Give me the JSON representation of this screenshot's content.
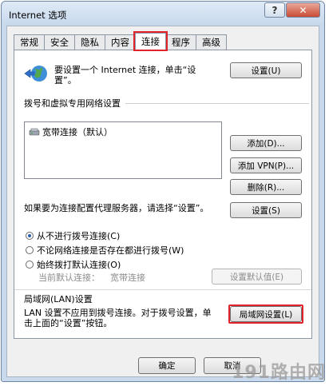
{
  "window": {
    "title": "Internet 选项",
    "help": "?",
    "close": "✕"
  },
  "tabs": [
    "常规",
    "安全",
    "隐私",
    "内容",
    "连接",
    "程序",
    "高级"
  ],
  "active_tab": "连接",
  "setup": {
    "text": "要设置一个 Internet 连接，单击“设置”。",
    "button": "设置(U)"
  },
  "dialup_section": {
    "title": "拨号和虚拟专用网络设置",
    "items": [
      "宽带连接（默认）"
    ],
    "add_button": "添加(D)...",
    "add_vpn_button": "添加 VPN(P)...",
    "remove_button": "删除(R)...",
    "proxy_text": "如果要为连接配置代理服务器，请选择“设置”。",
    "settings_button": "设置(S)"
  },
  "radios": [
    {
      "label": "从不进行拨号连接(C)",
      "checked": true
    },
    {
      "label": "不论网络连接是否存在都进行拨号(W)",
      "checked": false
    },
    {
      "label": "始终拨打默认连接(O)",
      "checked": false
    }
  ],
  "default_row": {
    "label": "当前默认连接：",
    "value": "宽带连接",
    "button": "设置默认值(E)"
  },
  "lan_section": {
    "title": "局域网(LAN)设置",
    "text": "LAN 设置不应用到拨号连接。对于拨号设置，单击上面的“设置”按钮。",
    "button": "局域网设置(L)"
  },
  "footer": {
    "ok": "确定",
    "cancel": "取消"
  },
  "watermark": "191路由网"
}
